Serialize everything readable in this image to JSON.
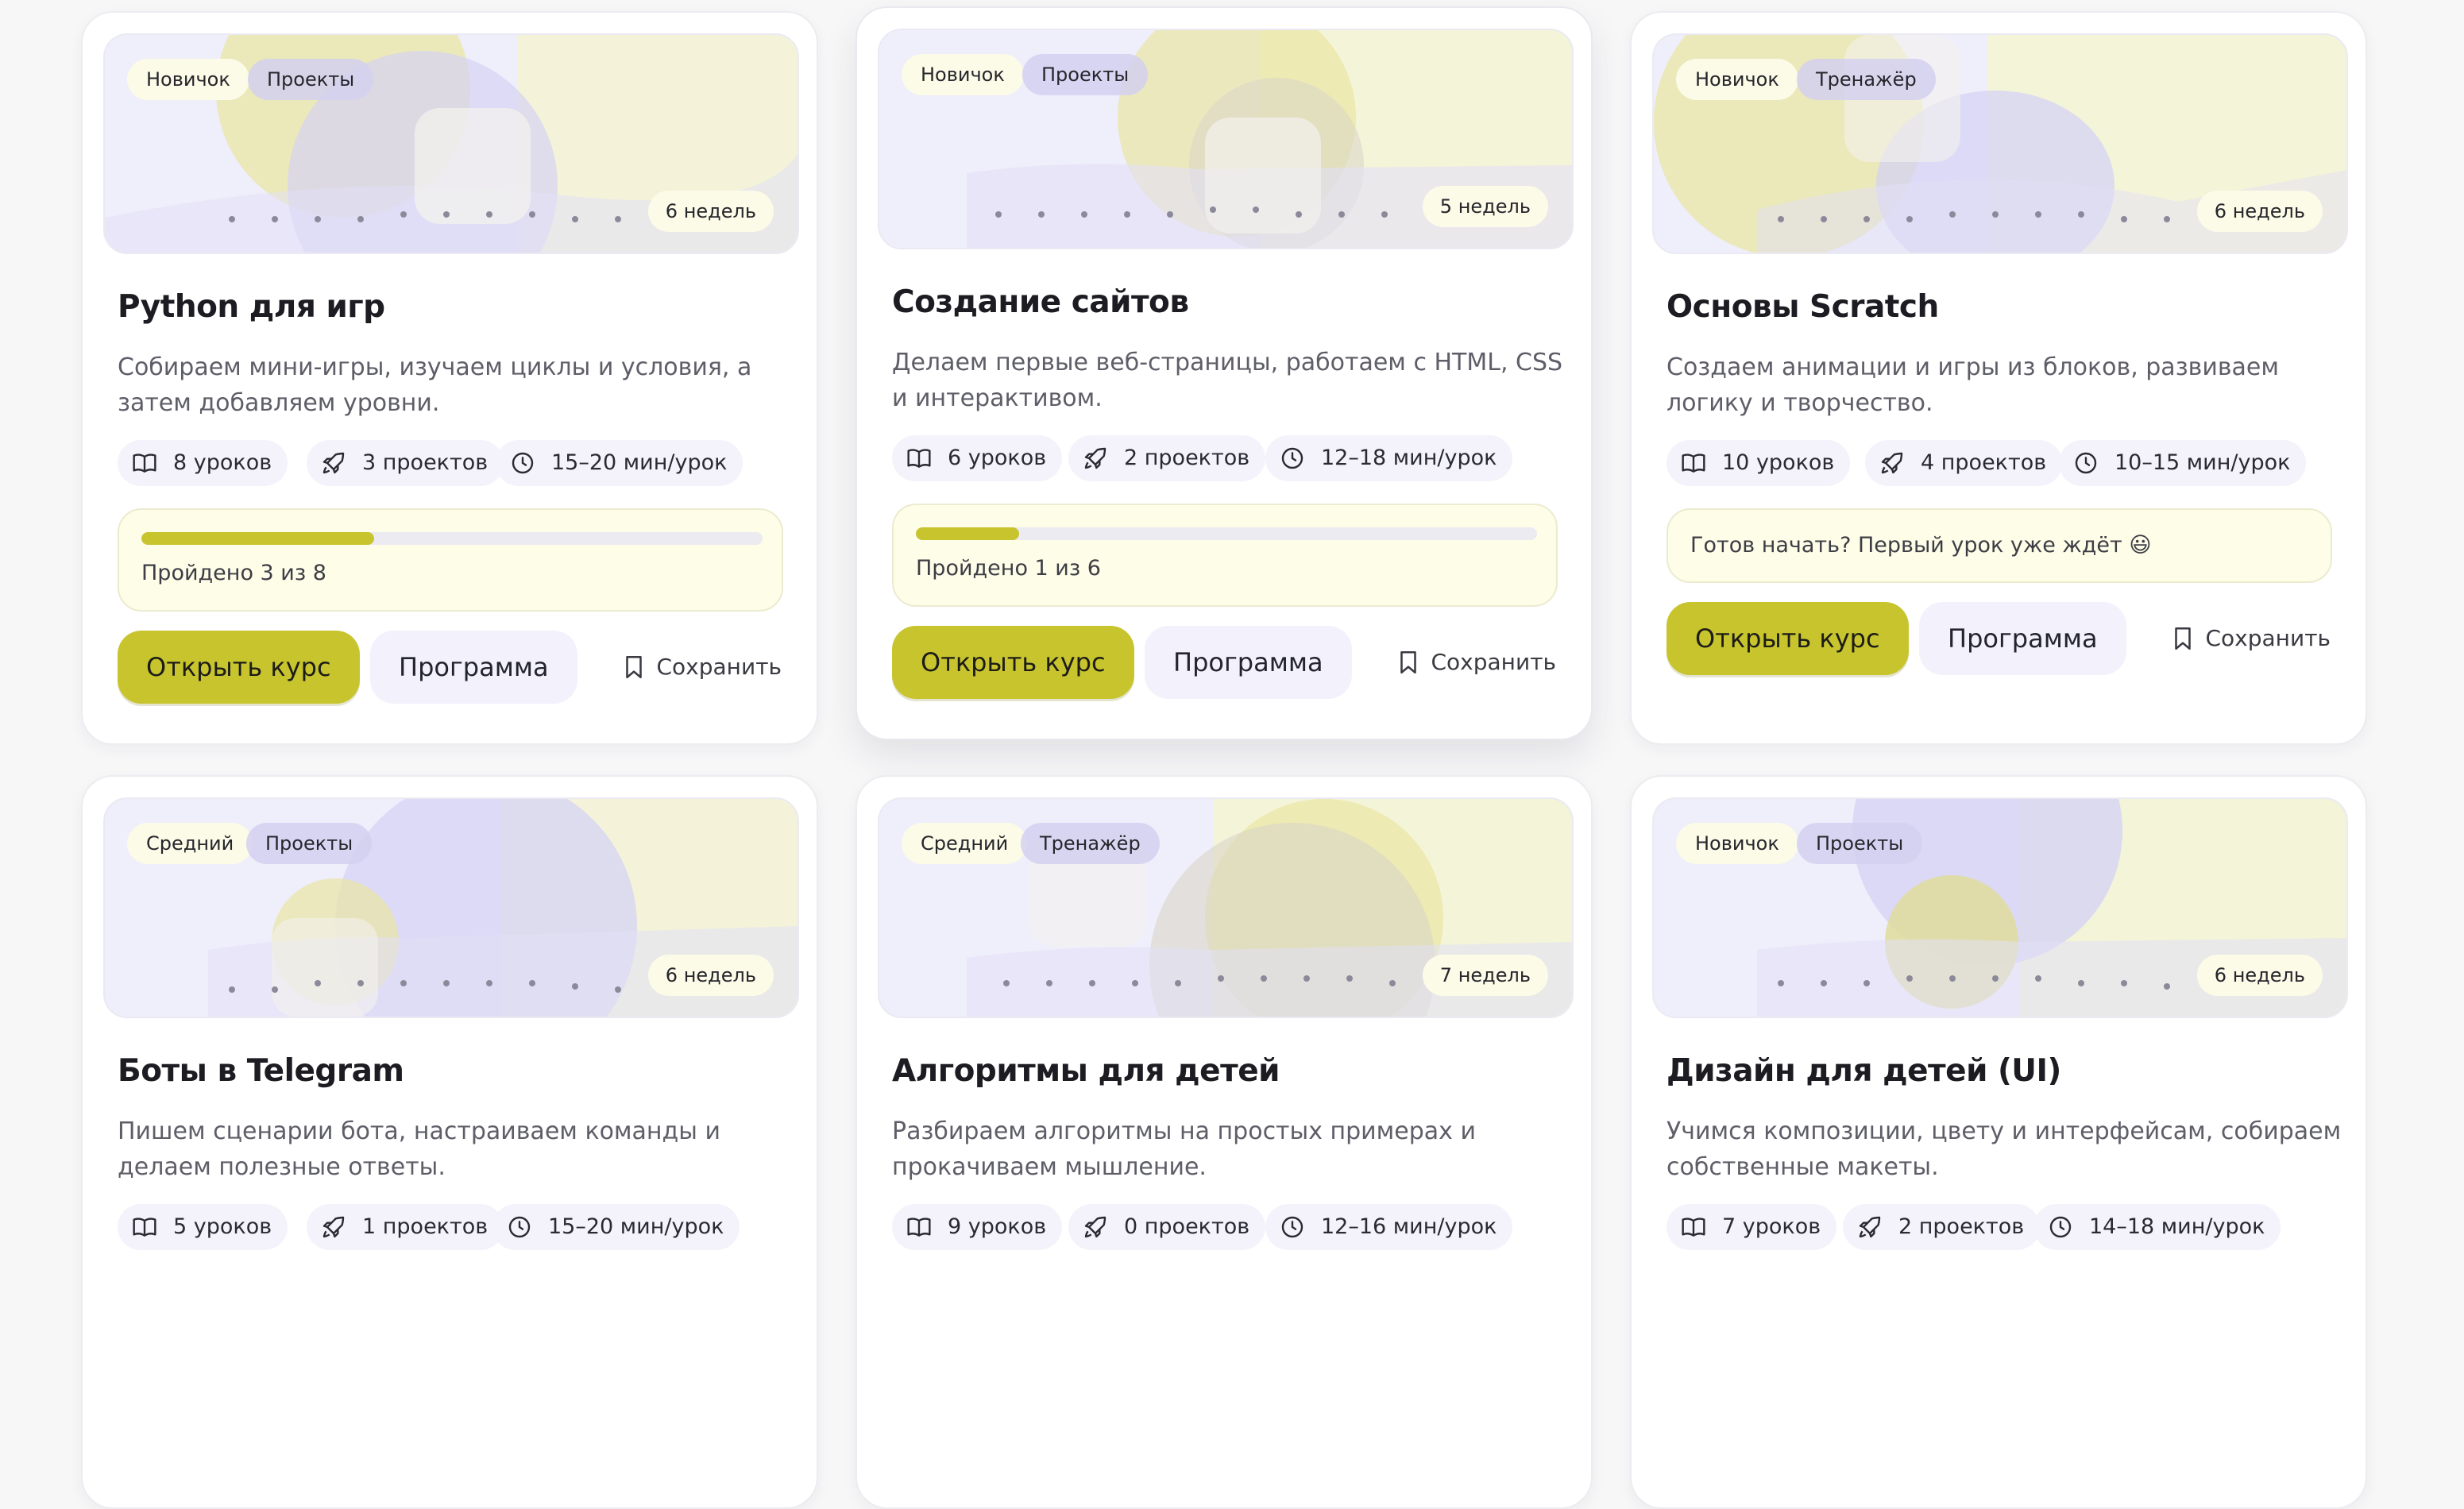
{
  "colors": {
    "accent": "#c8c42e",
    "lavender": "#d8d6f4",
    "cream": "#fdfde8"
  },
  "ui": {
    "open_label": "Открыть курс",
    "program_label": "Программа",
    "save_label": "Сохранить"
  },
  "courses": [
    {
      "level": "Новичок",
      "kind": "Проекты",
      "weeks": "6 недель",
      "title": "Python для игр",
      "description": "Собираем мини-игры, изучаем циклы и условия, а затем добавляем уровни.",
      "lessons": "8 уроков",
      "projects": "3 проектов",
      "duration": "15–20 мин/урок",
      "progress": {
        "completed": 3,
        "total": 8,
        "text": "Пройдено 3 из 8"
      }
    },
    {
      "level": "Новичок",
      "kind": "Проекты",
      "weeks": "5 недель",
      "title": "Создание сайтов",
      "description": "Делаем первые веб-страницы, работаем с HTML, CSS и интерактивом.",
      "lessons": "6 уроков",
      "projects": "2 проектов",
      "duration": "12–18 мин/урок",
      "progress": {
        "completed": 1,
        "total": 6,
        "text": "Пройдено 1 из 6"
      }
    },
    {
      "level": "Новичок",
      "kind": "Тренажёр",
      "weeks": "6 недель",
      "title": "Основы Scratch",
      "description": "Создаем анимации и игры из блоков, развиваем логику и творчество.",
      "lessons": "10 уроков",
      "projects": "4 проектов",
      "duration": "10–15 мин/урок",
      "notice": "Готов начать? Первый урок уже ждёт 😃"
    },
    {
      "level": "Средний",
      "kind": "Проекты",
      "weeks": "6 недель",
      "title": "Боты в Telegram",
      "description": "Пишем сценарии бота, настраиваем команды и делаем полезные ответы.",
      "lessons": "5 уроков",
      "projects": "1 проектов",
      "duration": "15–20 мин/урок"
    },
    {
      "level": "Средний",
      "kind": "Тренажёр",
      "weeks": "7 недель",
      "title": "Алгоритмы для детей",
      "description": "Разбираем алгоритмы на простых примерах и прокачиваем мышление.",
      "lessons": "9 уроков",
      "projects": "0 проектов",
      "duration": "12–16 мин/урок"
    },
    {
      "level": "Новичок",
      "kind": "Проекты",
      "weeks": "6 недель",
      "title": "Дизайн для детей (UI)",
      "description": "Учимся композиции, цвету и интерфейсам, собираем собственные макеты.",
      "lessons": "7 уроков",
      "projects": "2 проектов",
      "duration": "14–18 мин/урок"
    }
  ]
}
